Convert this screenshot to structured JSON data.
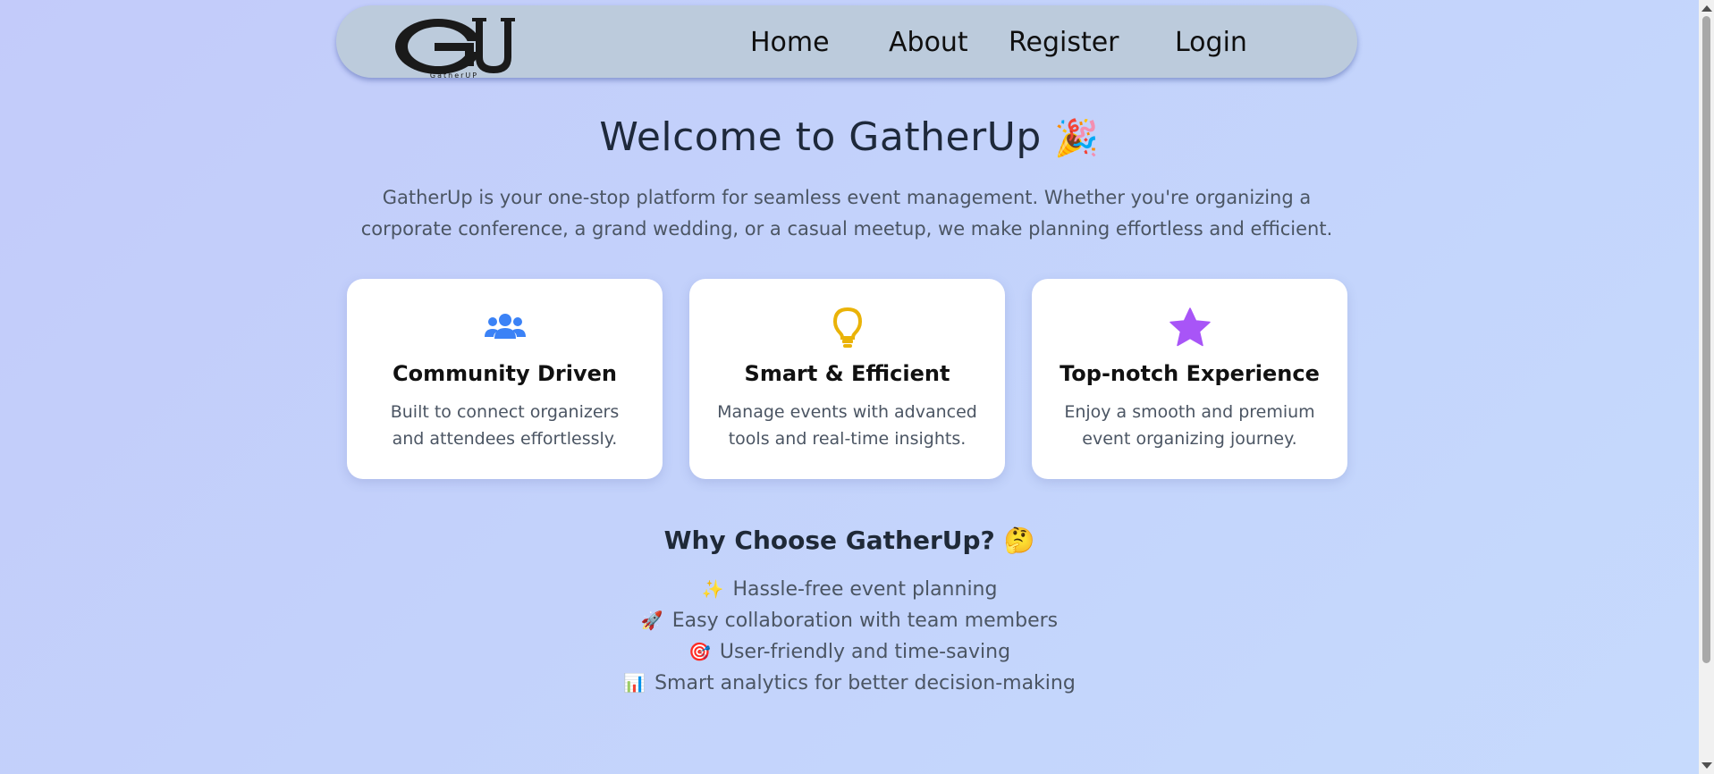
{
  "nav": {
    "logo_text": "GU",
    "logo_sub": "GatherUP",
    "links": [
      "Home",
      "About",
      "Register",
      "Login"
    ]
  },
  "hero": {
    "title": "Welcome to GatherUp",
    "title_emoji": "🎉",
    "description": "GatherUp is your one-stop platform for seamless event management. Whether you're organizing a corporate conference, a grand wedding, or a casual meetup, we make planning effortless and efficient."
  },
  "features": [
    {
      "icon": "users-icon",
      "color": "#3b82f6",
      "title": "Community Driven",
      "description": "Built to connect organizers and attendees effortlessly."
    },
    {
      "icon": "lightbulb-icon",
      "color": "#eab308",
      "title": "Smart & Efficient",
      "description": "Manage events with advanced tools and real-time insights."
    },
    {
      "icon": "star-icon",
      "color": "#a855f7",
      "title": "Top-notch Experience",
      "description": "Enjoy a smooth and premium event organizing journey."
    }
  ],
  "why": {
    "title": "Why Choose GatherUp?",
    "title_emoji": "🤔",
    "items": [
      {
        "emoji": "✨",
        "text": "Hassle-free event planning"
      },
      {
        "emoji": "🚀",
        "text": "Easy collaboration with team members"
      },
      {
        "emoji": "🎯",
        "text": "User-friendly and time-saving"
      },
      {
        "emoji": "📊",
        "text": "Smart analytics for better decision-making"
      }
    ]
  },
  "colors": {
    "navbar": "#bccbdc",
    "background_start": "#c3cbfa",
    "background_end": "#c6dafd",
    "heading": "#1e293b",
    "body_text": "#4b5563"
  }
}
